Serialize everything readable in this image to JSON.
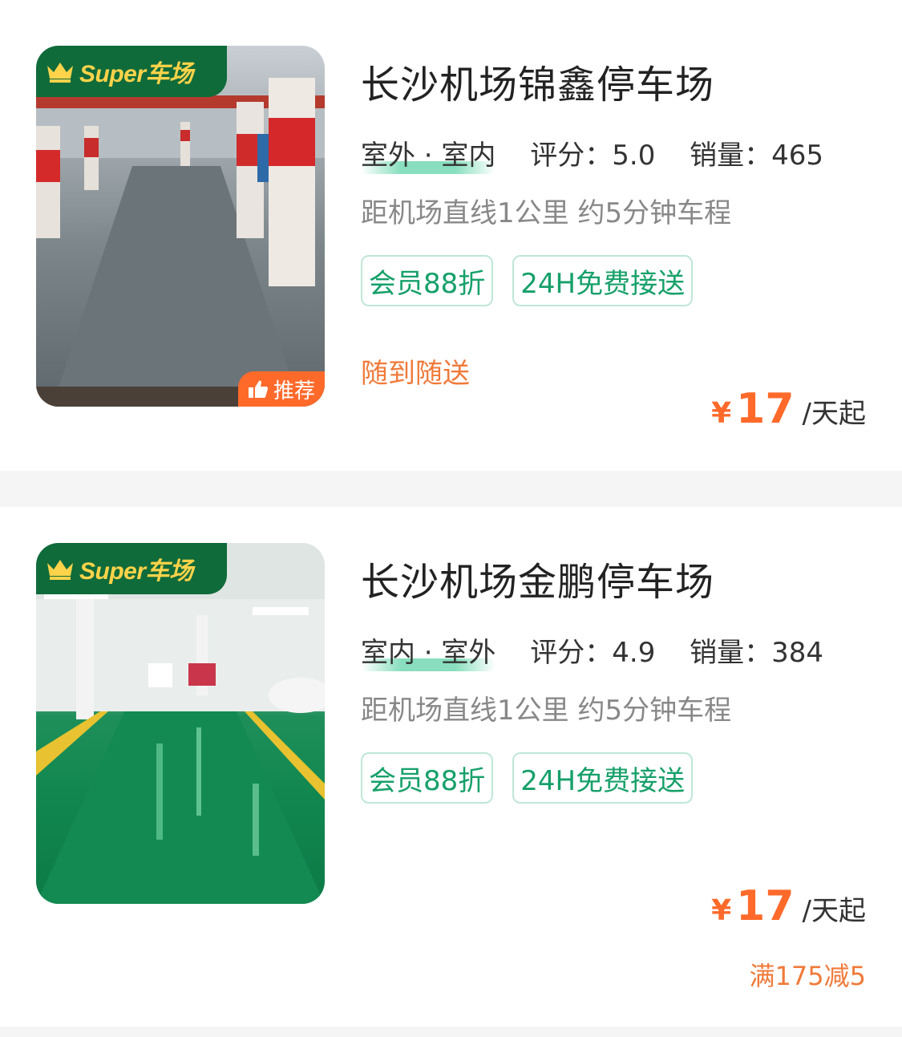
{
  "listings": [
    {
      "badge": "Super车场",
      "recommend_label": "推荐",
      "name": "长沙机场锦鑫停车场",
      "types": "室外 · 室内",
      "score_label": "评分：",
      "score": "5.0",
      "sales_label": "销量：",
      "sales": "465",
      "distance": "距机场直线1公里 约5分钟车程",
      "tags": [
        "会员88折",
        "24H免费接送"
      ],
      "delivery": "随到随送",
      "currency": "¥",
      "price": "17",
      "price_unit": "/天起"
    },
    {
      "badge": "Super车场",
      "name": "长沙机场金鹏停车场",
      "types": "室内 · 室外",
      "score_label": "评分：",
      "score": "4.9",
      "sales_label": "销量：",
      "sales": "384",
      "distance": "距机场直线1公里 约5分钟车程",
      "tags": [
        "会员88折",
        "24H免费接送"
      ],
      "currency": "¥",
      "price": "17",
      "price_unit": "/天起",
      "promo": "满175减5"
    }
  ],
  "colors": {
    "accent_green": "#16a06a",
    "badge_green": "#0f6b3a",
    "price_orange": "#ff6a2b",
    "promo_orange": "#f07a3a"
  },
  "icons": [
    "crown-icon",
    "thumbs-up-icon"
  ]
}
